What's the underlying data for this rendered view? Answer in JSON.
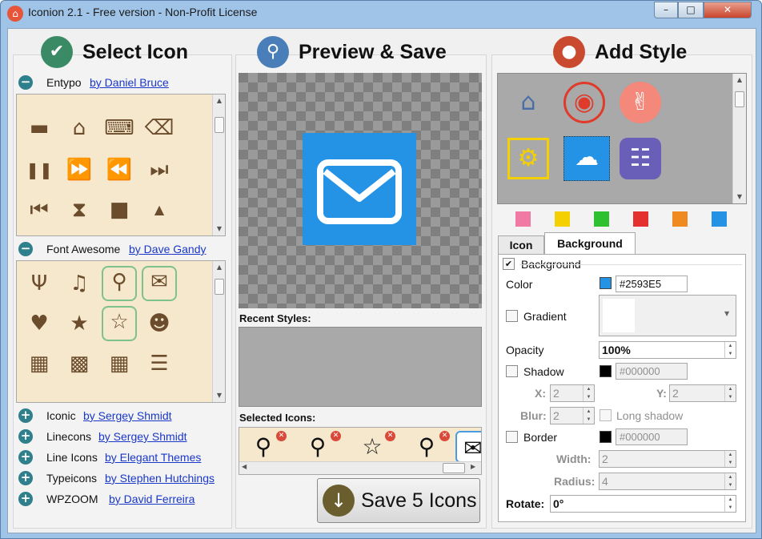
{
  "window": {
    "title": "Iconion 2.1 - Free version - Non-Profit License",
    "min_symbol": "–",
    "max_symbol": "□",
    "close_symbol": "✕",
    "app_icon": "⌂"
  },
  "panels": {
    "select": {
      "title": "Select Icon",
      "icon": "check-icon",
      "glyph": "✔"
    },
    "preview": {
      "title": "Preview & Save",
      "icon": "search-icon",
      "glyph": "⚲"
    },
    "style": {
      "title": "Add Style",
      "icon": "drop-icon",
      "glyph": "●"
    }
  },
  "libraries": {
    "entypo": {
      "name": "Entypo",
      "author": "by Daniel Bruce",
      "expanded": true,
      "toggle": "−"
    },
    "fontawesome": {
      "name": "Font Awesome",
      "author": "by Dave Gandy",
      "expanded": true,
      "toggle": "−"
    },
    "collapsed": [
      {
        "name": "Iconic",
        "author": "by Sergey Shmidt",
        "toggle": "+"
      },
      {
        "name": "Linecons",
        "author": "by Sergey Shmidt",
        "toggle": "+"
      },
      {
        "name": "Line Icons",
        "author": "by Elegant Themes",
        "toggle": "+"
      },
      {
        "name": "Typeicons",
        "author": "by Stephen Hutchings",
        "toggle": "+"
      },
      {
        "name": "WPZOOM",
        "author": "by David Ferreira",
        "toggle": "+"
      }
    ]
  },
  "entypo_icons": [
    "▬",
    "⌂",
    "⌨",
    "⌫",
    "❚❚",
    "⏩",
    "⏪",
    "⏭",
    "⏮",
    "⧗",
    "■",
    "▲"
  ],
  "fa_icons": [
    "Ψ",
    "♫",
    "⚲",
    "✉",
    "♥",
    "★",
    "☆",
    "☻",
    "▦",
    "▩",
    "▦",
    "☰"
  ],
  "preview": {
    "icon": "envelope-icon",
    "glyph": "✉",
    "background": "#2593E5"
  },
  "recent_styles_label": "Recent Styles:",
  "selected_icons_label": "Selected Icons:",
  "selected_icons": [
    "⚲",
    "⚲",
    "☆",
    "⚲",
    "✉"
  ],
  "remove_symbol": "✕",
  "save_button": {
    "label": "Save 5 Icons",
    "glyph": "↓"
  },
  "style_tiles": [
    "⌂",
    "◉",
    "✌",
    "⚙",
    "☁",
    "☷"
  ],
  "swatches": [
    "#f07aa4",
    "#f5d000",
    "#2ec02e",
    "#e53030",
    "#f08a20",
    "#2593e5"
  ],
  "tabs": {
    "icon": "Icon",
    "background": "Background"
  },
  "props": {
    "background_label": "Background",
    "background_checked": "✔",
    "color_label": "Color",
    "color_value": "#2593E5",
    "gradient_label": "Gradient",
    "opacity_label": "Opacity",
    "opacity_value": "100%",
    "shadow_label": "Shadow",
    "shadow_color": "#000000",
    "x_label": "X:",
    "x_value": "2",
    "y_label": "Y:",
    "y_value": "2",
    "blur_label": "Blur:",
    "blur_value": "2",
    "long_shadow_label": "Long shadow",
    "border_label": "Border",
    "border_color": "#000000",
    "width_label": "Width:",
    "width_value": "2",
    "radius_label": "Radius:",
    "radius_value": "4",
    "rotate_label": "Rotate:",
    "rotate_value": "0°"
  }
}
